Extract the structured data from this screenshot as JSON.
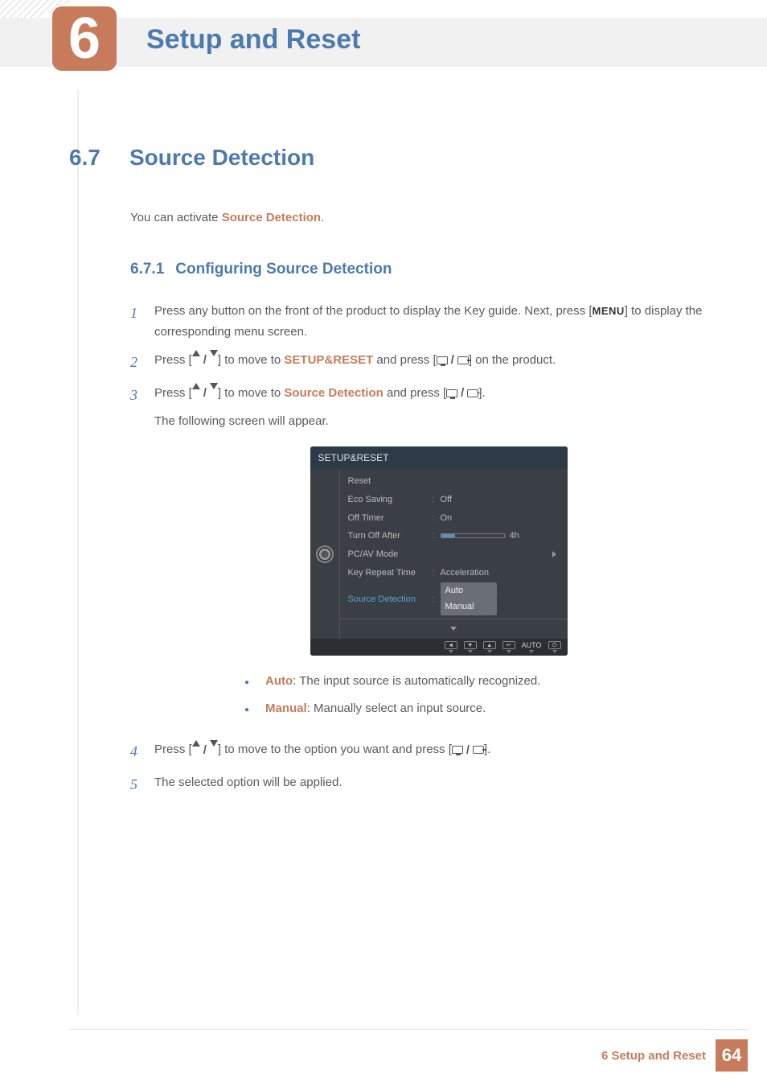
{
  "chapter": {
    "num": "6",
    "title": "Setup and Reset"
  },
  "section": {
    "num": "6.7",
    "title": "Source Detection"
  },
  "intro": {
    "prefix": "You can activate ",
    "term": "Source Detection",
    "suffix": "."
  },
  "subsection": {
    "num": "6.7.1",
    "title": "Configuring Source Detection"
  },
  "steps": {
    "s1": {
      "n": "1",
      "a": "Press any button on the front of the product to display the Key guide. Next, press [",
      "menu": "MENU",
      "b": "] to display the corresponding menu screen."
    },
    "s2": {
      "n": "2",
      "a": "Press [",
      "b": "] to move to ",
      "term": "SETUP&RESET",
      "c": " and press [",
      "d": "] on the product."
    },
    "s3": {
      "n": "3",
      "a": "Press [",
      "b": "] to move to ",
      "term": "Source Detection",
      "c": " and press [",
      "d": "].",
      "follow": "The following screen will appear."
    },
    "s4": {
      "n": "4",
      "a": "Press [",
      "b": "] to move to the option you want and press [",
      "c": "]."
    },
    "s5": {
      "n": "5",
      "text": "The selected option will be applied."
    }
  },
  "bullets": {
    "auto": {
      "term": "Auto",
      "text": ": The input source is automatically recognized."
    },
    "manual": {
      "term": "Manual",
      "text": ": Manually select an input source."
    }
  },
  "osd": {
    "title": "SETUP&RESET",
    "rows": {
      "reset": "Reset",
      "eco": "Eco Saving",
      "eco_v": "Off",
      "offt": "Off Timer",
      "offt_v": "On",
      "toa": "Turn Off After",
      "toa_v": "4h",
      "pcav": "PC/AV Mode",
      "krt": "Key Repeat Time",
      "krt_v": "Acceleration",
      "sd": "Source Detection",
      "sd_v1": "Auto",
      "sd_v2": "Manual"
    },
    "footer_auto": "AUTO"
  },
  "footer": {
    "chapter_label": "6 Setup and Reset",
    "page": "64"
  }
}
